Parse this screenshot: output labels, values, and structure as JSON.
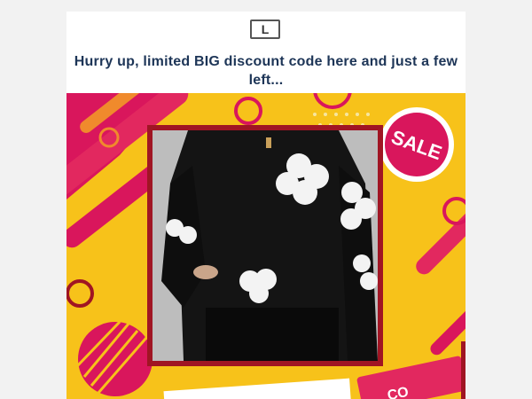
{
  "email": {
    "logo_letter": "L",
    "headline": "Hurry up, limited BIG discount code here and just a few left...",
    "sale_badge": "SALE",
    "coupon_partial": "CO"
  },
  "colors": {
    "background": "#f2f2f2",
    "headline": "#1d3557",
    "banner_yellow": "#f7c21a",
    "banner_magenta": "#d9165c",
    "frame": "#a01523"
  }
}
